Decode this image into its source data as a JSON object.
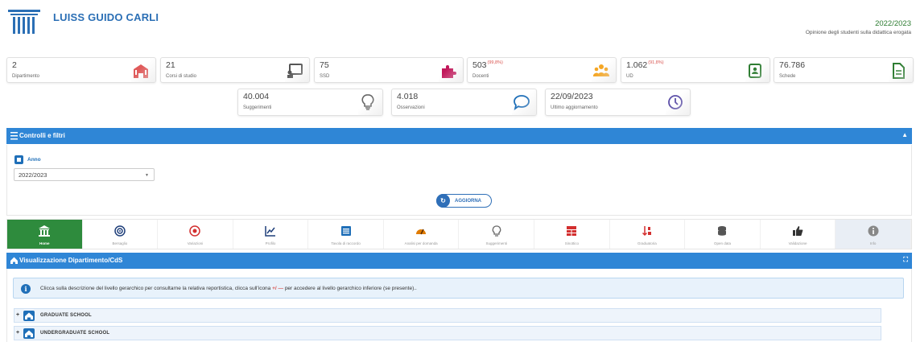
{
  "header": {
    "brand": "LUISS GUIDO CARLI",
    "year": "2022/2023",
    "subtitle": "Opinione degli studenti sulla didattica erogata"
  },
  "stats": [
    {
      "value": "2",
      "pct": "",
      "label": "Dipartimento",
      "icon": "building-icon",
      "color": "#e05a5a"
    },
    {
      "value": "21",
      "pct": "",
      "label": "Corsi di studio",
      "icon": "presentation-icon",
      "color": "#555555"
    },
    {
      "value": "75",
      "pct": "",
      "label": "SSD",
      "icon": "puzzle-icon",
      "color": "#c2185b"
    },
    {
      "value": "503",
      "pct": "(99,8%)",
      "label": "Docenti",
      "icon": "users-icon",
      "color": "#f5a623"
    },
    {
      "value": "1.062",
      "pct": "(91,8%)",
      "label": "UD",
      "icon": "contact-book-icon",
      "color": "#2e7d32"
    },
    {
      "value": "76.786",
      "pct": "",
      "label": "Schede",
      "icon": "document-icon",
      "color": "#2e7d32"
    },
    {
      "value": "40.004",
      "pct": "",
      "label": "Suggerimenti",
      "icon": "lightbulb-icon",
      "color": "#666666"
    },
    {
      "value": "4.018",
      "pct": "",
      "label": "Osservazioni",
      "icon": "speech-bubble-icon",
      "color": "#1f6fb8"
    },
    {
      "value": "22/09/2023",
      "pct": "",
      "label": "Ultimo aggiornamento",
      "icon": "clock-icon",
      "color": "#5c4fa8"
    }
  ],
  "filters": {
    "title": "Controlli e filtri",
    "anno_label": "Anno",
    "anno_value": "2022/2023",
    "refresh_label": "AGGIORNA"
  },
  "tabs": [
    {
      "label": "Home",
      "icon": "institution-icon"
    },
    {
      "label": "Bersaglio",
      "icon": "target-icon"
    },
    {
      "label": "Variazioni",
      "icon": "radio-dot-icon"
    },
    {
      "label": "Profilo",
      "icon": "line-chart-icon"
    },
    {
      "label": "Tavola di raccordo",
      "icon": "list-table-icon"
    },
    {
      "label": "Analisi per domanda",
      "icon": "gauge-icon"
    },
    {
      "label": "Suggerimenti",
      "icon": "lightbulb-icon"
    },
    {
      "label": "Sinottico",
      "icon": "grid-table-icon"
    },
    {
      "label": "Graduatoria",
      "icon": "sort-icon"
    },
    {
      "label": "Open data",
      "icon": "database-icon"
    },
    {
      "label": "Validazione",
      "icon": "thumbs-up-icon"
    },
    {
      "label": "Info",
      "icon": "info-icon"
    }
  ],
  "view": {
    "title": "Visualizzazione Dipartimento/CdS",
    "info_before": "Clicca sulla descrizione del livello gerarchico per consultarne la relativa reportistica, clicca sull'icona ",
    "info_symbol": "+/ —",
    "info_after": " per accedere al livello gerarchico inferiore (se presente)..",
    "rows": [
      "GRADUATE SCHOOL",
      "UNDERGRADUATE SCHOOL"
    ]
  },
  "colors": {
    "primary": "#2f86d6",
    "active_tab": "#2e8b3d",
    "brand": "#2b6fb5"
  }
}
